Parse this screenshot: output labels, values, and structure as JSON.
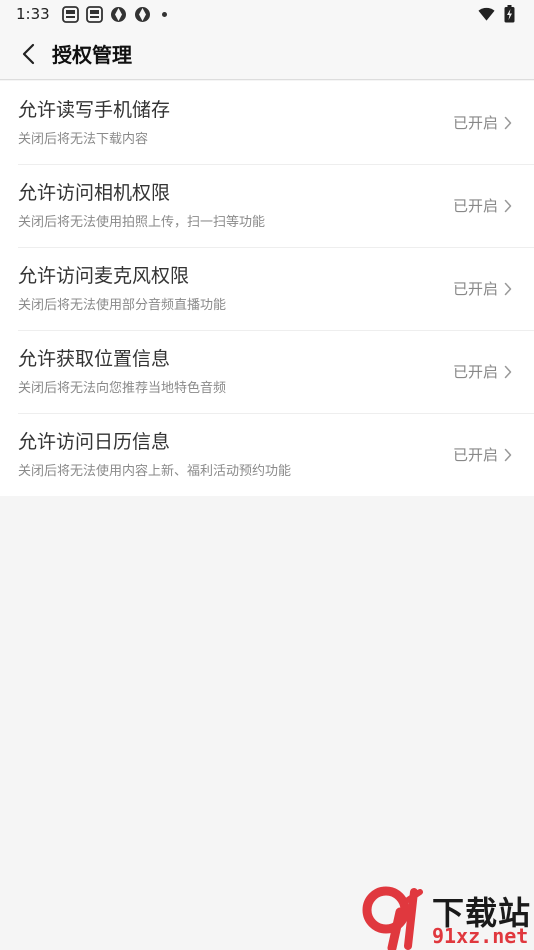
{
  "status_bar": {
    "time": "1:33"
  },
  "header": {
    "title": "授权管理"
  },
  "permissions": [
    {
      "title": "允许读写手机储存",
      "desc": "关闭后将无法下载内容",
      "status": "已开启"
    },
    {
      "title": "允许访问相机权限",
      "desc": "关闭后将无法使用拍照上传，扫一扫等功能",
      "status": "已开启"
    },
    {
      "title": "允许访问麦克风权限",
      "desc": "关闭后将无法使用部分音频直播功能",
      "status": "已开启"
    },
    {
      "title": "允许获取位置信息",
      "desc": "关闭后将无法向您推荐当地特色音频",
      "status": "已开启"
    },
    {
      "title": "允许访问日历信息",
      "desc": "关闭后将无法使用内容上新、福利活动预约功能",
      "status": "已开启"
    }
  ],
  "watermark": {
    "cn": "下载站",
    "en": "91xz.net"
  },
  "colors": {
    "background": "#f5f5f5",
    "row_background": "#ffffff",
    "watermark_red": "#e0383e"
  }
}
